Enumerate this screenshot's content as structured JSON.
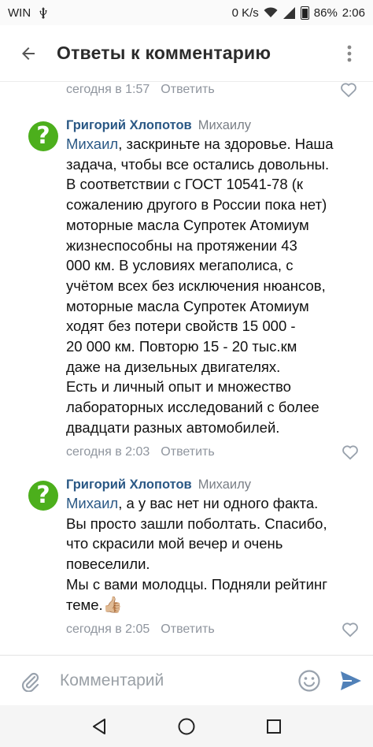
{
  "status_bar": {
    "carrier": "WIN",
    "speed": "0 K/s",
    "battery": "86%",
    "time": "2:06"
  },
  "header": {
    "title": "Ответы к комментарию"
  },
  "partial_comment": {
    "time": "сегодня в 1:57",
    "reply_label": "Ответить"
  },
  "comments": [
    {
      "author": "Григорий Хлопотов",
      "reply_to": "Михаилу",
      "mention": "Михаил",
      "lines": [
        ", заскриньте на здоровье. Наша",
        "задача, чтобы все остались довольны.",
        "В соответствии с ГОСТ 10541-78 (к",
        "сожалению другого в России пока нет)",
        "моторные масла Супротек Атомиум",
        "жизнеспособны на протяжении 43",
        "000 км. В условиях мегаполиса, с",
        "учётом всех без исключения нюансов,",
        "моторные масла Супротек Атомиум",
        "ходят без потери свойств 15 000 -",
        "20 000 км. Повторю 15 - 20 тыс.км",
        "даже на дизельных двигателях.",
        "Есть и личный опыт и множество",
        "лабораторных исследований с более",
        "двадцати разных автомобилей."
      ],
      "time": "сегодня в 2:03",
      "reply_label": "Ответить"
    },
    {
      "author": "Григорий Хлопотов",
      "reply_to": "Михаилу",
      "mention": "Михаил",
      "lines": [
        ", а у вас нет ни одного факта.",
        "Вы просто зашли поболтать. Спасибо,",
        "что скрасили мой вечер и очень",
        "повеселили.",
        "Мы с вами молодцы. Подняли рейтинг",
        "теме."
      ],
      "emoji": "👍🏼",
      "time": "сегодня в 2:05",
      "reply_label": "Ответить"
    }
  ],
  "input": {
    "placeholder": "Комментарий"
  },
  "avatar_glyph": "?",
  "colors": {
    "link": "#2a5885",
    "meta": "#8f959e",
    "send": "#5181b8",
    "avatar": "#4caf1c"
  }
}
